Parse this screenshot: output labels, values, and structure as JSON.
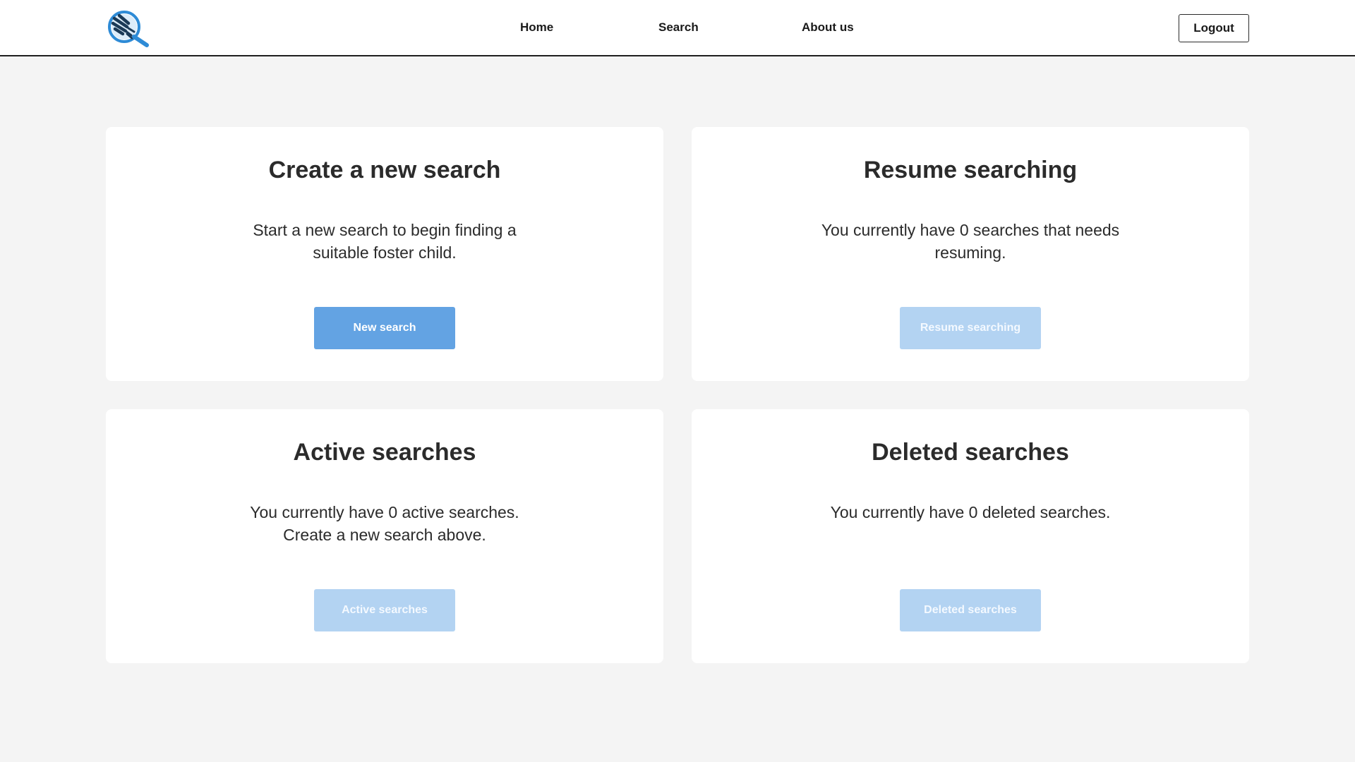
{
  "header": {
    "logo_icon": "magnifier-with-hands-icon",
    "nav": {
      "home": "Home",
      "search": "Search",
      "about": "About us"
    },
    "logout_label": "Logout"
  },
  "cards": {
    "new_search": {
      "title": "Create a new search",
      "text": "Start a new search to begin finding a suitable foster child.",
      "button": "New search"
    },
    "resume": {
      "title": "Resume searching",
      "text": "You currently have 0 searches that needs resuming.",
      "button": "Resume searching"
    },
    "active": {
      "title": "Active searches",
      "text": "You currently have 0 active searches. Create a new search above.",
      "button": "Active searches"
    },
    "deleted": {
      "title": "Deleted searches",
      "text": "You currently have 0 deleted searches.",
      "button": "Deleted searches"
    }
  },
  "colors": {
    "primary_button": "#63a3e3",
    "disabled_button": "#b3d3f2",
    "logo_blue": "#2e8bd6",
    "logo_dark": "#1b3a57",
    "page_bg": "#f4f4f4"
  }
}
